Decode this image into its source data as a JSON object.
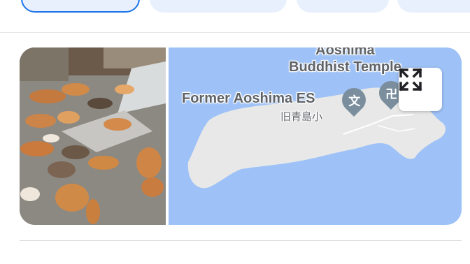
{
  "chips": [
    {
      "label": "",
      "active": true
    },
    {
      "label": "",
      "active": false
    },
    {
      "label": "",
      "active": false
    },
    {
      "label": "",
      "active": false
    }
  ],
  "photo": {
    "alt": "",
    "icon": "cats-photo"
  },
  "map": {
    "places": {
      "temple_line1": "Aoshima",
      "temple_line2": "Buddhist Temple",
      "school_name": "Former Aoshima ES",
      "school_name_jp": "旧青島小"
    },
    "pins": {
      "school_glyph": "文",
      "temple_glyph": "卍"
    },
    "expand_icon": "fullscreen-icon",
    "colors": {
      "water": "#9ec2f7",
      "land": "#e8e8e8",
      "pin": "#7a8e9d"
    }
  }
}
